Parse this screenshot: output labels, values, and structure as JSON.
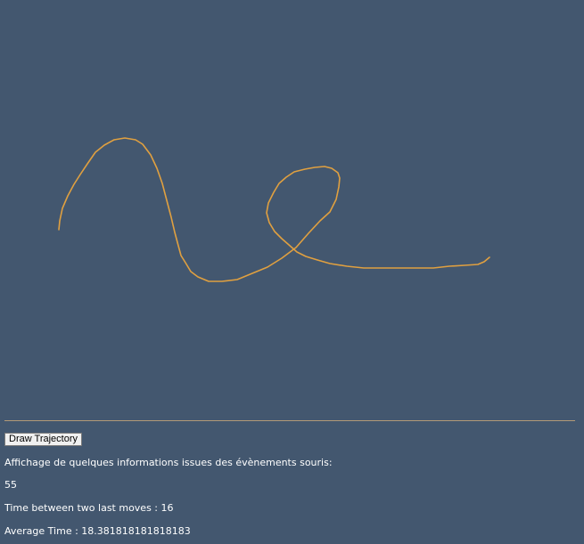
{
  "canvas": {
    "background": "#43576f",
    "stroke_color": "#e0a040"
  },
  "controls": {
    "draw_button_label": "Draw Trajectory"
  },
  "info": {
    "heading": "Affichage de quelques informations issues des évènements souris:",
    "count": "55",
    "time_between_moves": "Time between two last moves : 16",
    "average_time": "Average Time : 18.381818181818183"
  }
}
